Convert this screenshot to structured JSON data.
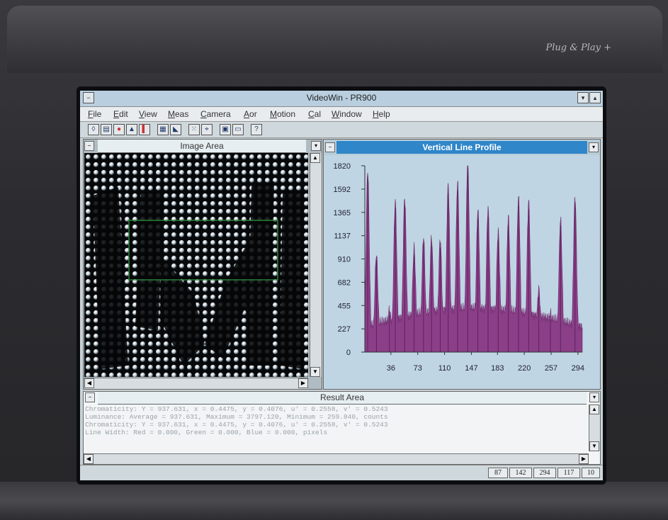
{
  "brand": "Plug & Play +",
  "window": {
    "title": "VideoWin - PR900",
    "control_box": "−",
    "minimize": "▾",
    "maximize": "▴"
  },
  "menu": [
    "File",
    "Edit",
    "View",
    "Meas",
    "Camera",
    "Aor",
    "Motion",
    "Cal",
    "Window",
    "Help"
  ],
  "toolbar_icons": [
    "lamp-icon",
    "print-icon",
    "color-icon",
    "triangle-icon",
    "palette-icon",
    "grid-icon",
    "profile-icon",
    "target-icon",
    "crosshair-icon",
    "calc-icon",
    "disk-icon",
    "help-icon"
  ],
  "image_area": {
    "title": "Image Area",
    "control": "−",
    "dropdown": "▾"
  },
  "profile": {
    "title": "Vertical Line Profile",
    "control": "−",
    "dropdown": "▾"
  },
  "chart_data": {
    "type": "area",
    "title": "Vertical Line Profile",
    "color": "#8b3f88",
    "yticks": [
      0,
      227,
      455,
      682,
      910,
      1137,
      1365,
      1592,
      1820
    ],
    "xticks": [
      36,
      73,
      110,
      147,
      183,
      220,
      257,
      294
    ],
    "ylim": [
      0,
      1820
    ],
    "xlim": [
      0,
      300
    ],
    "peaks": [
      {
        "x": 4,
        "y": 1720
      },
      {
        "x": 16,
        "y": 900
      },
      {
        "x": 34,
        "y": 360
      },
      {
        "x": 42,
        "y": 1410
      },
      {
        "x": 55,
        "y": 1440
      },
      {
        "x": 68,
        "y": 950
      },
      {
        "x": 81,
        "y": 1050
      },
      {
        "x": 92,
        "y": 1040
      },
      {
        "x": 104,
        "y": 1020
      },
      {
        "x": 115,
        "y": 1550
      },
      {
        "x": 128,
        "y": 1580
      },
      {
        "x": 142,
        "y": 1800
      },
      {
        "x": 156,
        "y": 1300
      },
      {
        "x": 170,
        "y": 1320
      },
      {
        "x": 184,
        "y": 1100
      },
      {
        "x": 198,
        "y": 1240
      },
      {
        "x": 212,
        "y": 1430
      },
      {
        "x": 226,
        "y": 1400
      },
      {
        "x": 240,
        "y": 550
      },
      {
        "x": 256,
        "y": 320
      },
      {
        "x": 270,
        "y": 1240
      },
      {
        "x": 290,
        "y": 1460
      }
    ]
  },
  "result_area": {
    "title": "Result Area",
    "control": "−",
    "lines": [
      "Chromaticity: Y  = 937.631, x  = 0.4475, y  = 0.4076, u' = 0.2558, v' = 0.5243",
      "Luminance: Average = 937.631, Maximum = 3797.120, Minimum = 259.840, counts",
      "Chromaticity: Y  = 937.631, x  = 0.4475, y  = 0.4076, u' = 0.2558, v' = 0.5243",
      "Line Width: Red =  0.000, Green =  0.000, Blue =  0.000, pixels"
    ]
  },
  "status": [
    "87",
    "142",
    "294",
    "117",
    "10"
  ]
}
